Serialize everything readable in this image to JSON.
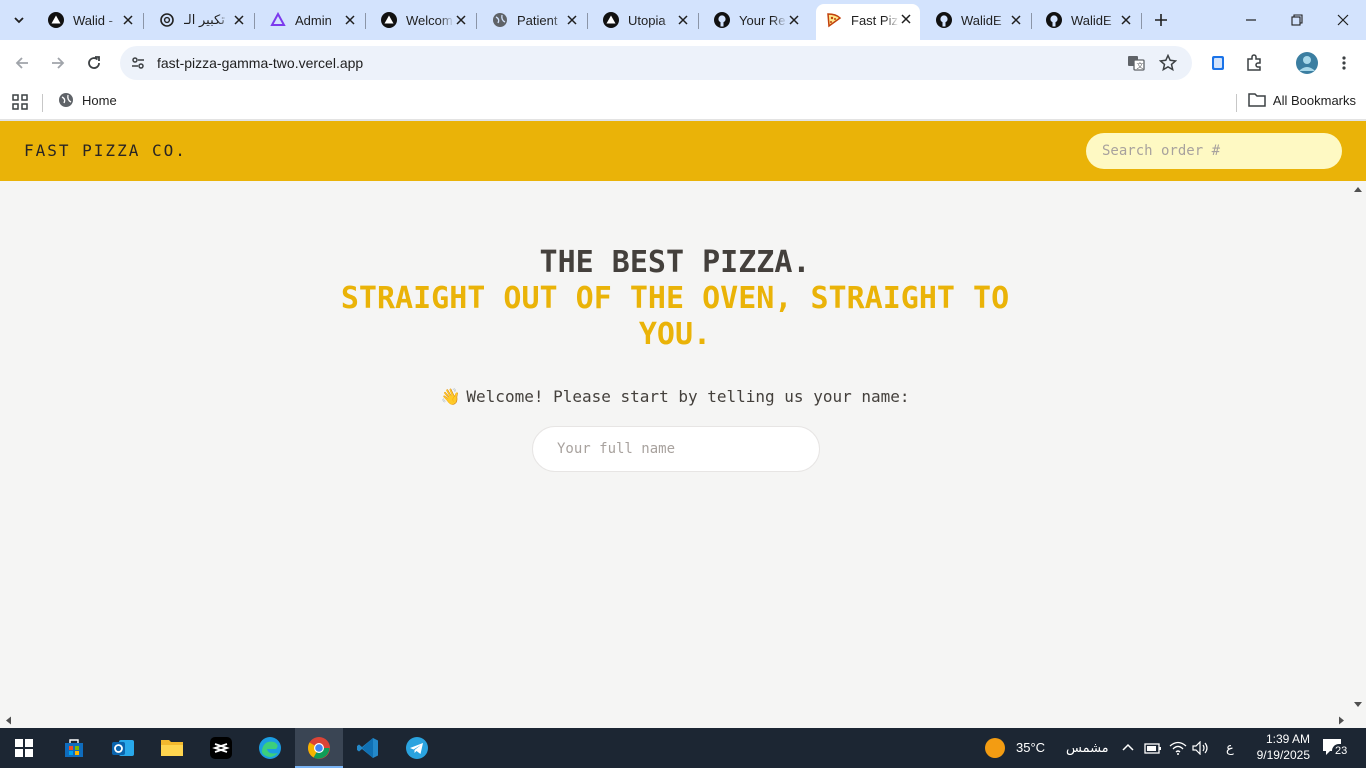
{
  "browser": {
    "tabs": [
      {
        "title": "Walid -",
        "icon": "triangle-logo-icon"
      },
      {
        "title": "تكبير الـ",
        "icon": "openai-icon"
      },
      {
        "title": "Admin",
        "icon": "admin-logo-icon"
      },
      {
        "title": "Welcom",
        "icon": "triangle-logo-icon"
      },
      {
        "title": "Patient",
        "icon": "globe-icon"
      },
      {
        "title": "Utopia",
        "icon": "triangle-logo-icon"
      },
      {
        "title": "Your Re",
        "icon": "github-icon"
      },
      {
        "title": "Fast Piz",
        "icon": "pizza-icon",
        "active": true
      },
      {
        "title": "WalidE",
        "icon": "github-icon"
      },
      {
        "title": "WalidE",
        "icon": "github-icon"
      }
    ],
    "url": "fast-pizza-gamma-two.vercel.app",
    "bookmarks": {
      "home": "Home",
      "all": "All Bookmarks"
    }
  },
  "app": {
    "logo": "FAST PIZZA CO.",
    "search_placeholder": "Search order #",
    "hero_line1": "THE BEST PIZZA.",
    "hero_line2": "STRAIGHT OUT OF THE OVEN, STRAIGHT TO YOU.",
    "wave": "👋",
    "welcome": "Welcome! Please start by telling us your name:",
    "name_placeholder": "Your full name",
    "colors": {
      "brand": "#eab308",
      "background": "#f5f5f4",
      "text": "#44403c"
    }
  },
  "taskbar": {
    "apps": [
      "windows-start",
      "microsoft-store",
      "outlook",
      "file-explorer",
      "capcut",
      "edge",
      "chrome",
      "vscode",
      "telegram"
    ],
    "weather_temp": "35°C",
    "weather_desc": "مشمس",
    "input_lang": "ع",
    "time": "1:39 AM",
    "date": "9/19/2025",
    "notifications": "23"
  }
}
